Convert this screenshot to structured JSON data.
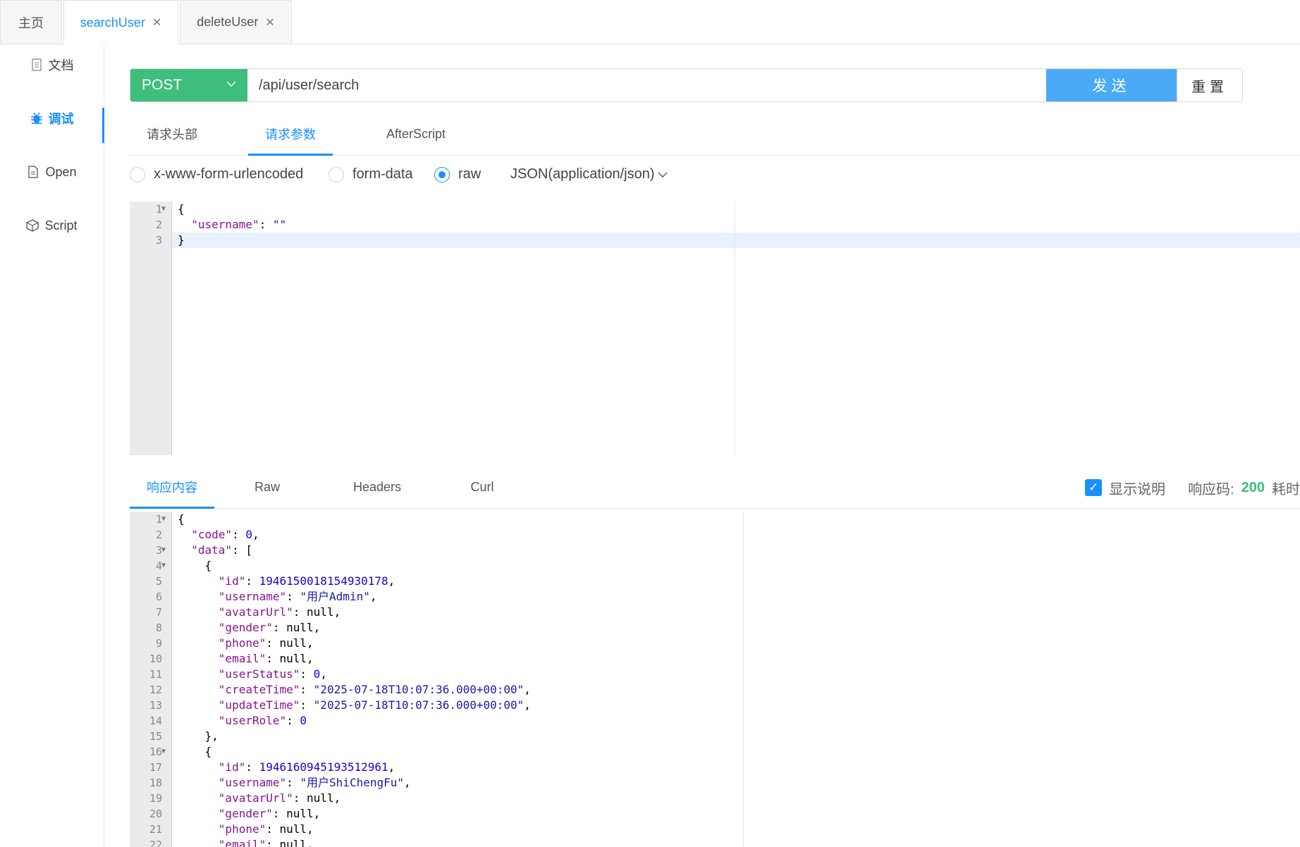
{
  "tabs": [
    {
      "label": "主页",
      "closable": false
    },
    {
      "label": "searchUser",
      "closable": true,
      "active": true
    },
    {
      "label": "deleteUser",
      "closable": true
    }
  ],
  "nav": [
    {
      "label": "文档",
      "icon": "document-icon"
    },
    {
      "label": "调试",
      "icon": "bug-icon",
      "active": true
    },
    {
      "label": "Open",
      "icon": "file-icon"
    },
    {
      "label": "Script",
      "icon": "code-box-icon"
    }
  ],
  "request": {
    "method": "POST",
    "url": "/api/user/search",
    "send_label": "发送",
    "reset_label": "重置"
  },
  "request_tabs": [
    "请求头部",
    "请求参数",
    "AfterScript"
  ],
  "body_types": [
    {
      "label": "x-www-form-urlencoded",
      "selected": false
    },
    {
      "label": "form-data",
      "selected": false
    },
    {
      "label": "raw",
      "selected": true
    }
  ],
  "content_type": "JSON(application/json)",
  "request_body": [
    "{",
    "  \"username\": \"\"",
    "}"
  ],
  "response_tabs": [
    "响应内容",
    "Raw",
    "Headers",
    "Curl"
  ],
  "response_meta": {
    "show_desc_label": "显示说明",
    "show_desc_checked": true,
    "status_label": "响应码:",
    "status_code": "200",
    "time_label_partial": "耗时"
  },
  "response_body": [
    "{",
    "  \"code\": 0,",
    "  \"data\": [",
    "    {",
    "      \"id\": 1946150018154930178,",
    "      \"username\": \"用户Admin\",",
    "      \"avatarUrl\": null,",
    "      \"gender\": null,",
    "      \"phone\": null,",
    "      \"email\": null,",
    "      \"userStatus\": 0,",
    "      \"createTime\": \"2025-07-18T10:07:36.000+00:00\",",
    "      \"updateTime\": \"2025-07-18T10:07:36.000+00:00\",",
    "      \"userRole\": 0",
    "    },",
    "    {",
    "      \"id\": 1946160945193512961,",
    "      \"username\": \"用户ShiChengFu\",",
    "      \"avatarUrl\": null,",
    "      \"gender\": null,",
    "      \"phone\": null,",
    "      \"email\": null,"
  ],
  "colors": {
    "accent": "#1890ff",
    "method_bg": "#3ebd7c",
    "send_bg": "#4aaaf5"
  }
}
